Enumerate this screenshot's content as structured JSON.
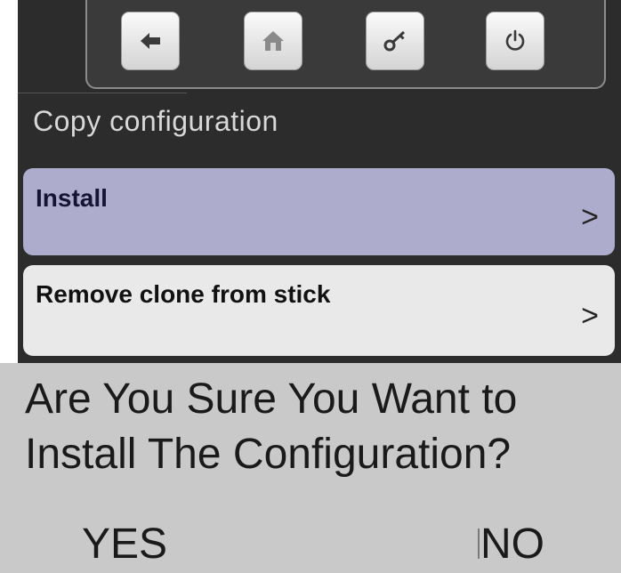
{
  "nav": {
    "buttons": [
      {
        "name": "back",
        "icon": "arrow-left-icon"
      },
      {
        "name": "home",
        "icon": "house-icon"
      },
      {
        "name": "key",
        "icon": "key-icon"
      },
      {
        "name": "power",
        "icon": "power-icon"
      }
    ]
  },
  "screen": {
    "title": "Copy configuration",
    "menu": [
      {
        "label": "Install",
        "chevron": ">",
        "selected": true
      },
      {
        "label": "Remove clone from stick",
        "chevron": ">",
        "selected": false
      }
    ]
  },
  "dialog": {
    "line1": "Are You Sure You Want to",
    "line2": "Install The Configuration?",
    "yes_label": "YES",
    "no_label": "NO"
  },
  "colors": {
    "selected_item": "#aeaccc",
    "unselected_item": "#e9e9e9",
    "screen_bg": "#2c2c2c",
    "dialog_bg": "#c9c9c9"
  }
}
